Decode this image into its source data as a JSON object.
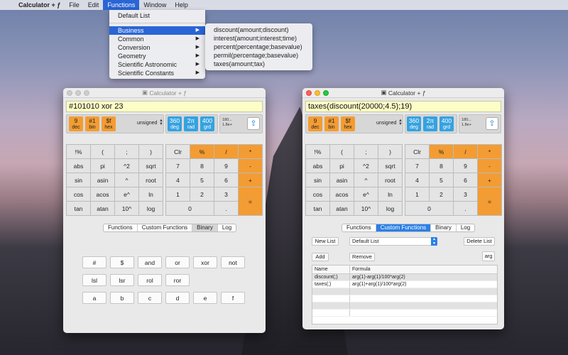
{
  "menubar": {
    "app": "Calculator + ƒ",
    "items": [
      "File",
      "Edit",
      "Functions",
      "Window",
      "Help"
    ]
  },
  "functions_menu": {
    "items": [
      {
        "label": "Default List",
        "arrow": ""
      },
      {
        "label": "Business",
        "arrow": "▶"
      },
      {
        "label": "Common",
        "arrow": "▶"
      },
      {
        "label": "Conversion",
        "arrow": "▶"
      },
      {
        "label": "Geometry",
        "arrow": "▶"
      },
      {
        "label": "Scientific Astronomic",
        "arrow": "▶"
      },
      {
        "label": "Scientific Constants",
        "arrow": "▶"
      }
    ]
  },
  "business_submenu": [
    "discount(amount;discount)",
    "interest(amount;interest;time)",
    "percent(percentage;basevalue)",
    "permil(percentage;basevalue)",
    "taxes(amount;tax)"
  ],
  "windows": {
    "title": "Calculator + ƒ",
    "w1_display": "#101010 xor 23",
    "w2_display": "taxes(discount(20000;4.5);19)",
    "base_buttons": [
      {
        "top": "9",
        "bottom": "dec"
      },
      {
        "top": "#1",
        "bottom": "bin"
      },
      {
        "top": "$f",
        "bottom": "hex"
      }
    ],
    "unsigned": "unsigned",
    "angle_buttons": [
      {
        "top": "360",
        "bottom": "deg"
      },
      {
        "top": "2π",
        "bottom": "rad"
      },
      {
        "top": "400",
        "bottom": "grd"
      }
    ],
    "range_top": "180...",
    "range_bottom": "1.8e+"
  },
  "sci_keys": [
    "!%",
    "(",
    ";",
    ")",
    "abs",
    "pi",
    "^2",
    "sqrt",
    "sin",
    "asin",
    "^",
    "root",
    "cos",
    "acos",
    "e^",
    "ln",
    "tan",
    "atan",
    "10^",
    "log"
  ],
  "num_keys": {
    "row1": [
      "Clr",
      "%",
      "/",
      "*"
    ],
    "row2": [
      "7",
      "8",
      "9",
      "-"
    ],
    "row3": [
      "4",
      "5",
      "6",
      "+"
    ],
    "row4": [
      "1",
      "2",
      "3",
      "="
    ],
    "row5": [
      "0",
      "."
    ]
  },
  "tabs": [
    "Functions",
    "Custom Functions",
    "Binary",
    "Log"
  ],
  "binary_keys": [
    "#",
    "$",
    "and",
    "or",
    "xor",
    "not",
    "lsl",
    "lsr",
    "rol",
    "ror",
    "a",
    "b",
    "c",
    "d",
    "e",
    "f"
  ],
  "custom": {
    "new_list": "New List",
    "list_value": "Default List",
    "delete_list": "Delete List",
    "add": "Add",
    "remove": "Remove",
    "arg": "arg",
    "col_name": "Name",
    "col_formula": "Formula",
    "rows": [
      {
        "name": "discount(;)",
        "formula": "arg(1)-arg(1)/100*arg(2)"
      },
      {
        "name": "taxes(;)",
        "formula": "arg(1)+arg(1)/100*arg(2)"
      }
    ]
  }
}
